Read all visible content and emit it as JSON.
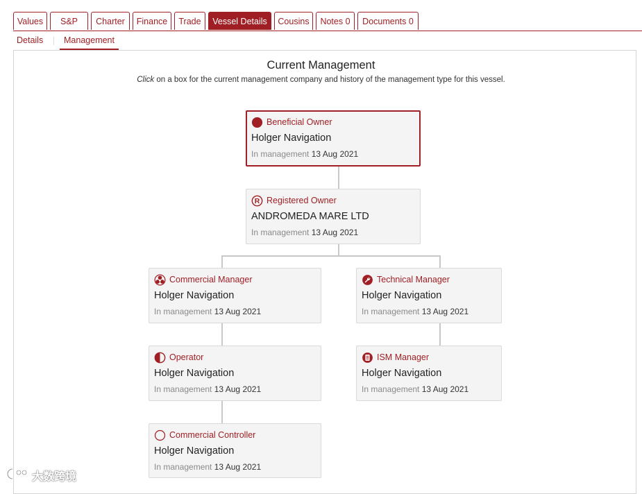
{
  "tabs": [
    {
      "label": "Values",
      "active": false
    },
    {
      "label": "S&P",
      "active": false
    },
    {
      "label": "Charter",
      "active": false
    },
    {
      "label": "Finance",
      "active": false
    },
    {
      "label": "Trade",
      "active": false
    },
    {
      "label": "Vessel Details",
      "active": true
    },
    {
      "label": "Cousins",
      "active": false
    },
    {
      "label": "Notes 0",
      "active": false
    },
    {
      "label": "Documents 0",
      "active": false
    }
  ],
  "subtabs": [
    {
      "label": "Details",
      "active": false
    },
    {
      "label": "Management",
      "active": true
    }
  ],
  "panel": {
    "title": "Current Management",
    "hint_lead": "Click",
    "hint_rest": " on a box for the current management company and history of the management type for this vessel."
  },
  "management": {
    "beneficial_owner": {
      "role": "Beneficial Owner",
      "company": "Holger Navigation",
      "since_label": "In management",
      "since_date": "13 Aug 2021",
      "icon": "filled-circle-icon",
      "selected": true
    },
    "registered_owner": {
      "role": "Registered Owner",
      "company": "ANDROMEDA MARE LTD",
      "since_label": "In management",
      "since_date": "13 Aug 2021",
      "icon": "registered-r-icon"
    },
    "commercial_manager": {
      "role": "Commercial Manager",
      "company": "Holger Navigation",
      "since_label": "In management",
      "since_date": "13 Aug 2021",
      "icon": "commercial-manager-icon"
    },
    "technical_manager": {
      "role": "Technical Manager",
      "company": "Holger Navigation",
      "since_label": "In management",
      "since_date": "13 Aug 2021",
      "icon": "wrench-circle-icon"
    },
    "operator": {
      "role": "Operator",
      "company": "Holger Navigation",
      "since_label": "In management",
      "since_date": "13 Aug 2021",
      "icon": "half-circle-icon"
    },
    "ism_manager": {
      "role": "ISM Manager",
      "company": "Holger Navigation",
      "since_label": "In management",
      "since_date": "13 Aug 2021",
      "icon": "document-circle-icon"
    },
    "commercial_controller": {
      "role": "Commercial Controller",
      "company": "Holger Navigation",
      "since_label": "In management",
      "since_date": "13 Aug 2021",
      "icon": "empty-circle-icon"
    }
  },
  "watermark": {
    "text": "大数跨境"
  },
  "colors": {
    "accent": "#a01f24",
    "box_background": "#f4f4f4",
    "connector": "#c8c8c8"
  }
}
